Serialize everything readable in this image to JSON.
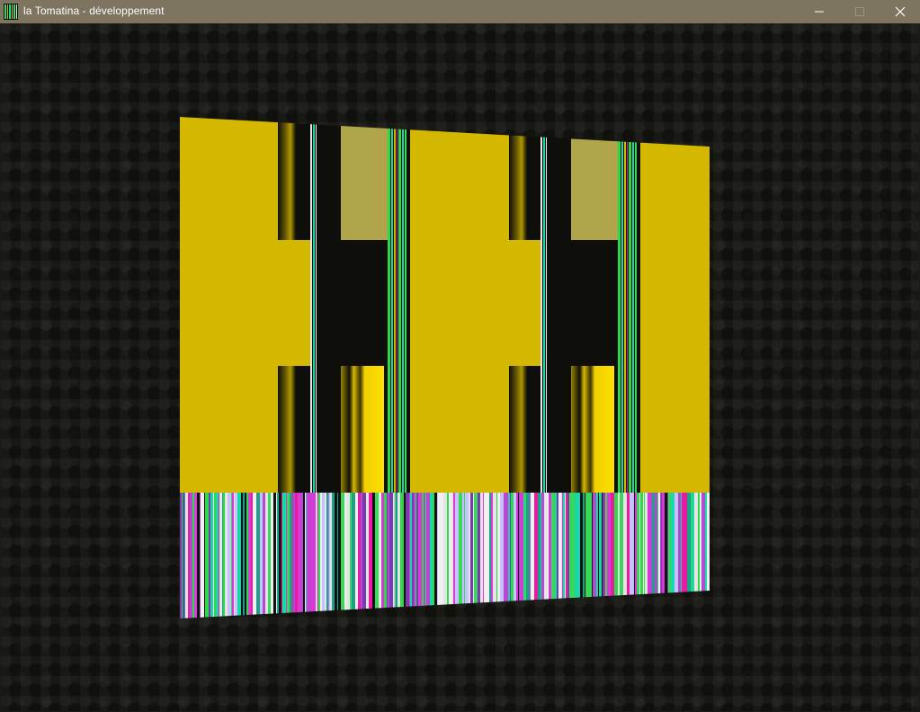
{
  "window": {
    "title": "la Tomatina - développement",
    "icon": "app-stripes-icon",
    "controls": [
      "minimize-icon",
      "maximize-icon",
      "close-icon"
    ]
  },
  "colors": {
    "titlebar": "#7d7560",
    "background": "#181814",
    "yellow": "#d4b800",
    "khaki": "#b0a54a",
    "dark": "#0e0e0a",
    "stripe_palette": [
      "#b04bd2",
      "#d83ad8",
      "#2fd84a",
      "#19d8a8",
      "#e4e4e4",
      "#111111",
      "#7a3ab0",
      "#c8c0ff",
      "#3ad85a",
      "#e81ca0",
      "#1f9f8a",
      "#f0f0f0"
    ]
  }
}
